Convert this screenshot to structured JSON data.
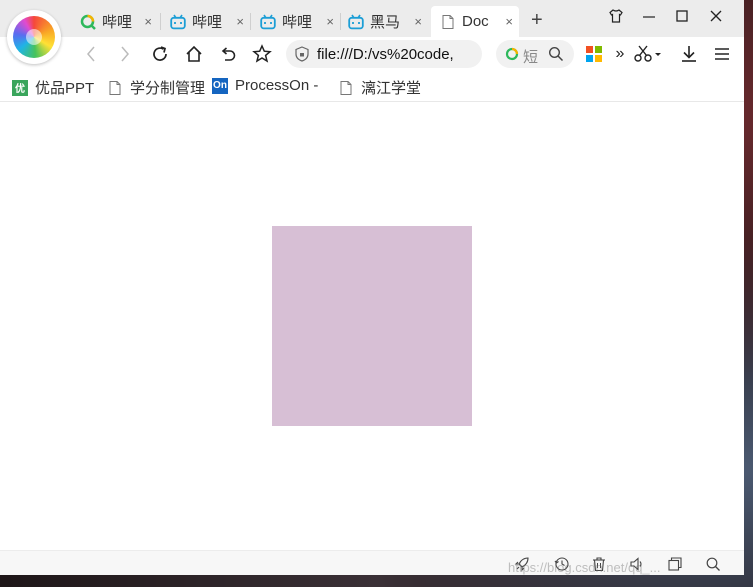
{
  "browser": {
    "tabs": [
      {
        "label": "哔哩",
        "icon": "search-circle-icon",
        "active": false
      },
      {
        "label": "哔哩",
        "icon": "bilibili-icon",
        "active": false
      },
      {
        "label": "哔哩",
        "icon": "bilibili-icon",
        "active": false
      },
      {
        "label": "黑马",
        "icon": "bilibili-icon",
        "active": false
      },
      {
        "label": "Doc",
        "icon": "document-icon",
        "active": true
      }
    ],
    "tab_close_glyph": "×",
    "new_tab_glyph": "+",
    "address": "file:///D:/vs%20code,",
    "search_label": "短"
  },
  "bookmarks": [
    {
      "label": "优品PPT",
      "icon_text": "优",
      "icon_color": "#3aa55c"
    },
    {
      "label": "学分制管理",
      "icon": "document-icon"
    },
    {
      "label": "ProcessOn -",
      "icon_text": "On",
      "icon_color": "#1565c0"
    },
    {
      "label": "漓江学堂",
      "icon": "document-icon"
    }
  ],
  "page": {
    "box_color": "#d7bfd5"
  },
  "watermark": "https://blog.csdn.net/qq_..."
}
